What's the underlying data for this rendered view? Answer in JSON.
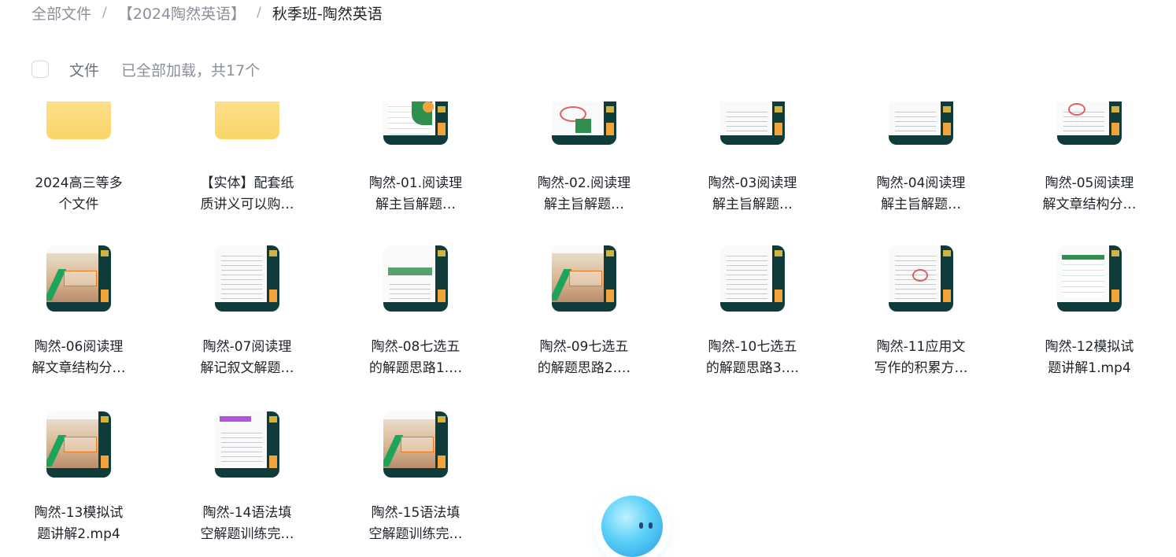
{
  "breadcrumb": {
    "root": "全部文件",
    "parent": "【2024陶然英语】",
    "current": "秋季班-陶然英语",
    "separator": "/"
  },
  "toolbar": {
    "label": "文件",
    "status": "已全部加载，共17个"
  },
  "files": [
    {
      "name": "2024高三等多个文件",
      "line1": "2024高三等多",
      "line2": "个文件",
      "icon": "folder-icon"
    },
    {
      "name": "【实体】配套纸质讲义可以购…",
      "line1": "【实体】配套纸",
      "line2": "质讲义可以购…",
      "icon": "folder-icon"
    },
    {
      "name": "陶然-01.阅读理解主旨解题…",
      "line1": "陶然-01.阅读理",
      "line2": "解主旨解题…",
      "icon": "video-thumbnail"
    },
    {
      "name": "陶然-02.阅读理解主旨解题…",
      "line1": "陶然-02.阅读理",
      "line2": "解主旨解题…",
      "icon": "video-thumbnail"
    },
    {
      "name": "陶然-03阅读理解主旨解题…",
      "line1": "陶然-03阅读理",
      "line2": "解主旨解题…",
      "icon": "video-thumbnail"
    },
    {
      "name": "陶然-04阅读理解主旨解题…",
      "line1": "陶然-04阅读理",
      "line2": "解主旨解题…",
      "icon": "video-thumbnail"
    },
    {
      "name": "陶然-05阅读理解文章结构分…",
      "line1": "陶然-05阅读理",
      "line2": "解文章结构分…",
      "icon": "video-thumbnail"
    },
    {
      "name": "陶然-06阅读理解文章结构分…",
      "line1": "陶然-06阅读理",
      "line2": "解文章结构分…",
      "icon": "video-thumbnail"
    },
    {
      "name": "陶然-07阅读理解记叙文解题…",
      "line1": "陶然-07阅读理",
      "line2": "解记叙文解题…",
      "icon": "video-thumbnail"
    },
    {
      "name": "陶然-08七选五的解题思路1.…",
      "line1": "陶然-08七选五",
      "line2": "的解题思路1.…",
      "icon": "video-thumbnail"
    },
    {
      "name": "陶然-09七选五的解题思路2.…",
      "line1": "陶然-09七选五",
      "line2": "的解题思路2.…",
      "icon": "video-thumbnail"
    },
    {
      "name": "陶然-10七选五的解题思路3.…",
      "line1": "陶然-10七选五",
      "line2": "的解题思路3.…",
      "icon": "video-thumbnail"
    },
    {
      "name": "陶然-11应用文写作的积累方…",
      "line1": "陶然-11应用文",
      "line2": "写作的积累方…",
      "icon": "video-thumbnail"
    },
    {
      "name": "陶然-12模拟试题讲解1.mp4",
      "line1": "陶然-12模拟试",
      "line2": "题讲解1.mp4",
      "icon": "video-thumbnail"
    },
    {
      "name": "陶然-13模拟试题讲解2.mp4",
      "line1": "陶然-13模拟试",
      "line2": "题讲解2.mp4",
      "icon": "video-thumbnail"
    },
    {
      "name": "陶然-14语法填空解题训练完…",
      "line1": "陶然-14语法填",
      "line2": "空解题训练完…",
      "icon": "video-thumbnail"
    },
    {
      "name": "陶然-15语法填空解题训练完…",
      "line1": "陶然-15语法填",
      "line2": "空解题训练完…",
      "icon": "video-thumbnail"
    }
  ],
  "colors": {
    "folder": "#fcd970",
    "slide_dark": "#0f3b3a",
    "accent_green": "#1ea35a",
    "text_muted": "#8a8f99"
  }
}
